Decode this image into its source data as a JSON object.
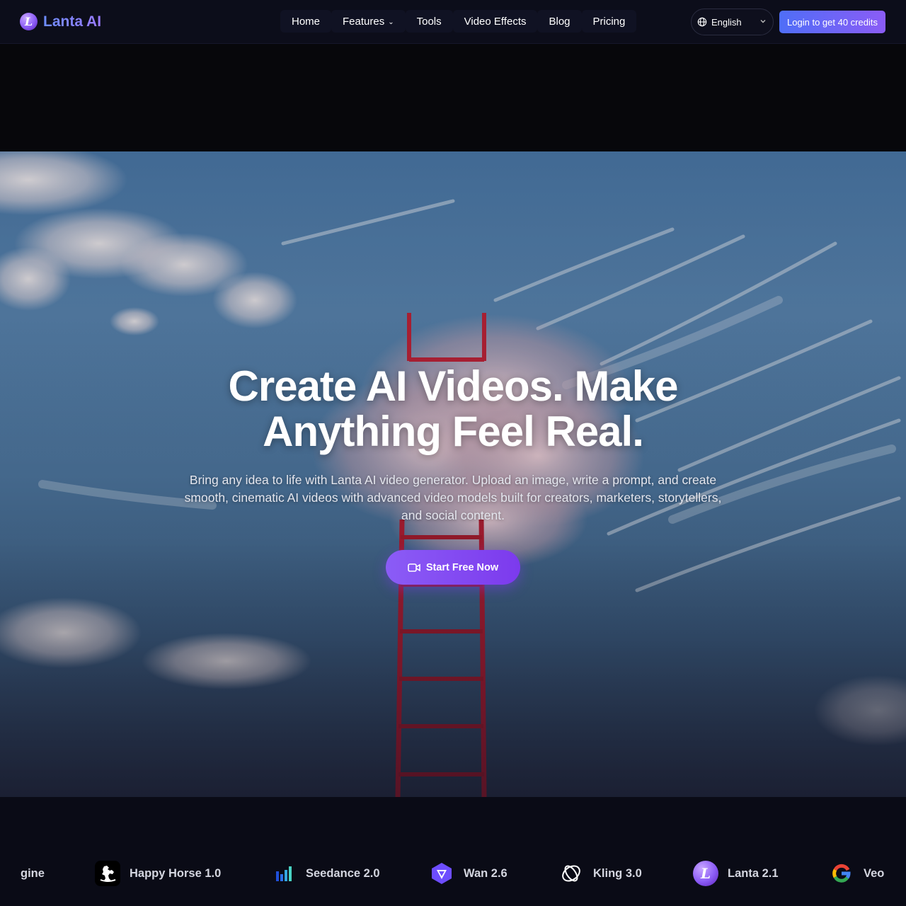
{
  "brand": {
    "name": "Lanta AI",
    "logo_letter": "L"
  },
  "nav": {
    "links": [
      {
        "label": "Home"
      },
      {
        "label": "Features",
        "has_dropdown": true
      },
      {
        "label": "Tools"
      },
      {
        "label": "Video Effects"
      },
      {
        "label": "Blog"
      },
      {
        "label": "Pricing"
      }
    ],
    "language": "English",
    "login_label": "Login to get 40 credits"
  },
  "hero": {
    "headline_line1": "Create AI Videos. Make",
    "headline_line2": "Anything Feel Real.",
    "subtitle": "Bring any idea to life with Lanta AI video generator. Upload an image, write a prompt, and create smooth, cinematic AI videos with advanced video models built for creators, marketers, storytellers, and social content.",
    "cta_label": "Start Free Now"
  },
  "models": [
    {
      "name": "gine",
      "icon": "none"
    },
    {
      "name": "Happy Horse 1.0",
      "icon": "horse-icon"
    },
    {
      "name": "Seedance 2.0",
      "icon": "bars-icon"
    },
    {
      "name": "Wan 2.6",
      "icon": "wan-icon"
    },
    {
      "name": "Kling 3.0",
      "icon": "kling-icon"
    },
    {
      "name": "Lanta 2.1",
      "icon": "lanta-icon"
    },
    {
      "name": "Veo",
      "icon": "google-icon"
    }
  ],
  "colors": {
    "accent": "#8b5cf6",
    "accent_blue": "#4f6ef7",
    "nav_bg": "#0c0d1a"
  }
}
